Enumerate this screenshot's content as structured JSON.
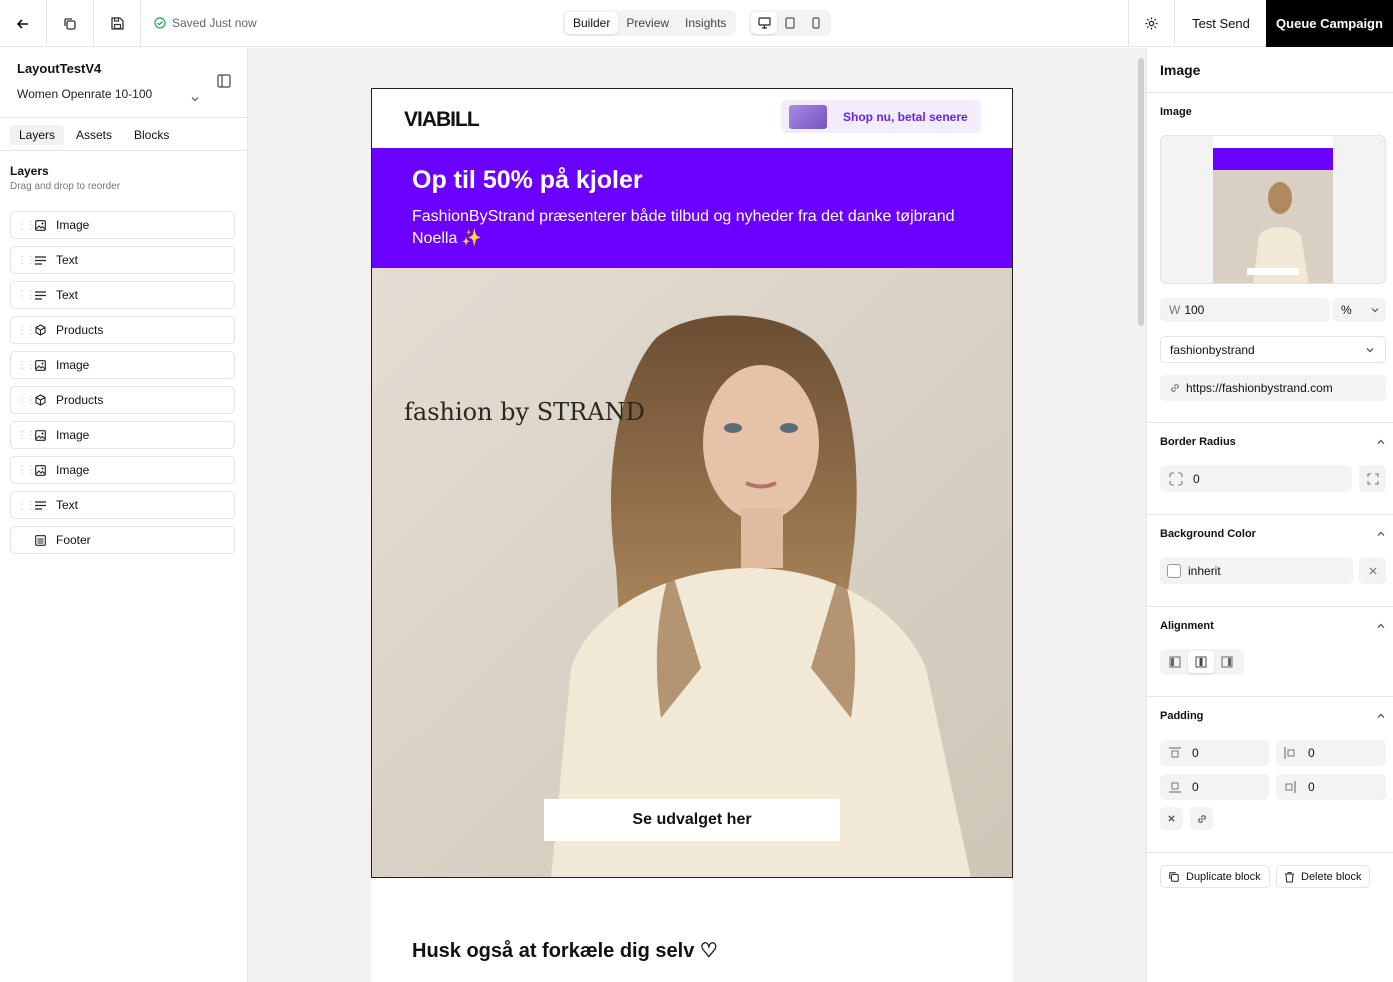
{
  "topbar": {
    "saved_text": "Saved Just now",
    "modes": [
      "Builder",
      "Preview",
      "Insights"
    ],
    "active_mode": "Builder",
    "test_send": "Test Send",
    "queue_campaign": "Queue Campaign",
    "accent": "#000000"
  },
  "left": {
    "project_name": "LayoutTestV4",
    "segment": "Women Openrate 10-100",
    "tabs": [
      "Layers",
      "Assets",
      "Blocks"
    ],
    "layers_title": "Layers",
    "layers_subtitle": "Drag and drop to reorder",
    "layers": [
      {
        "label": "Image",
        "icon": "image-icon"
      },
      {
        "label": "Text",
        "icon": "text-icon"
      },
      {
        "label": "Text",
        "icon": "text-icon"
      },
      {
        "label": "Products",
        "icon": "box-icon"
      },
      {
        "label": "Image",
        "icon": "image-icon"
      },
      {
        "label": "Products",
        "icon": "box-icon"
      },
      {
        "label": "Image",
        "icon": "image-icon"
      },
      {
        "label": "Image",
        "icon": "image-icon"
      },
      {
        "label": "Text",
        "icon": "text-icon"
      },
      {
        "label": "Footer",
        "icon": "footer-icon"
      }
    ]
  },
  "email": {
    "brand": "VIABILL",
    "shop_button": "Shop nu, betal senere",
    "headline": "Op til 50% på kjoler",
    "subtext": "FashionByStrand præsenterer både tilbud og nyheder fra det danke tøjbrand Noella ✨",
    "photo_logo": "fashion by STRAND",
    "cta": "Se udvalget her",
    "section_title": "Husk også at forkæle dig selv ♡",
    "hero_color": "#6a00ff"
  },
  "right": {
    "title": "Image",
    "image_label": "Image",
    "width_prefix": "W",
    "width_value": "100",
    "width_unit": "%",
    "link_select": "fashionbystrand",
    "url": "https://fashionbystrand.com",
    "border_radius_label": "Border Radius",
    "border_radius_value": "0",
    "bg_label": "Background Color",
    "bg_value": "inherit",
    "alignment_label": "Alignment",
    "padding_label": "Padding",
    "padding_top": "0",
    "padding_right": "0",
    "padding_bottom": "0",
    "padding_left": "0",
    "duplicate": "Duplicate block",
    "delete": "Delete block"
  }
}
